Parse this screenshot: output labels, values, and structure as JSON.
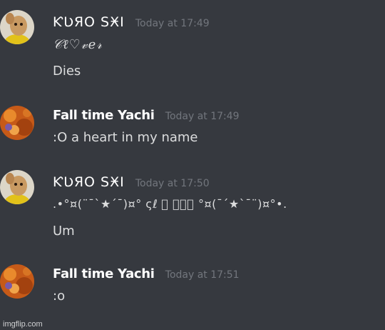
{
  "messages": [
    {
      "username": "ƘƲЯO SӾI",
      "timestamp": "Today at 17:49",
      "lines": [
        "𝒞ℓ♡𝓋𝑒𝓇",
        "Dies"
      ]
    },
    {
      "username": "Fall time Yachi",
      "timestamp": "Today at 17:49",
      "lines": [
        ":O a heart in my name"
      ]
    },
    {
      "username": "ƘƲЯO SӾI",
      "timestamp": "Today at 17:50",
      "lines": [
        ".•°¤(¨¯`★´¯)¤° ςℓ ⃣ 𝐕𝐄ⓡ °¤(¯´★`¯¨)¤°•.",
        "Um"
      ]
    },
    {
      "username": "Fall time Yachi",
      "timestamp": "Today at 17:51",
      "lines": [
        ":o"
      ]
    }
  ],
  "watermark": "imgflip.com"
}
